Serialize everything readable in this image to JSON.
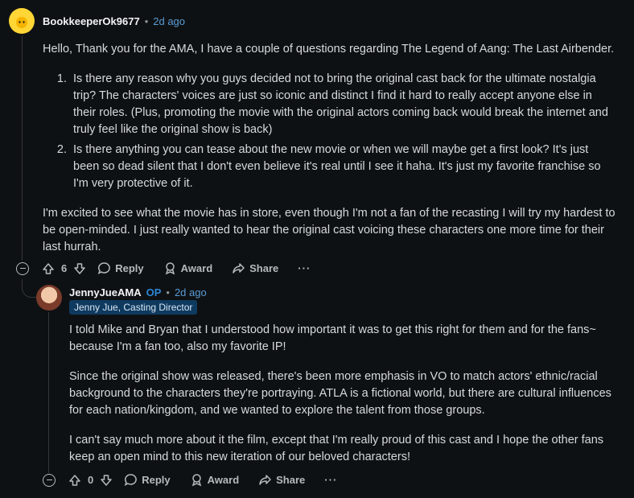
{
  "comment": {
    "username": "BookkeeperOk9677",
    "time": "2d ago",
    "intro": "Hello, Thank you for the AMA, I have a couple of questions regarding The Legend of Aang: The Last Airbender.",
    "items": [
      {
        "num": "1.",
        "text": "Is there any reason why you guys decided not to bring the original cast back for the ultimate nostalgia trip? The characters' voices are just so iconic and distinct I find it hard to really accept anyone else in their roles. (Plus, promoting the movie with the original actors coming back would break the internet and truly feel like the original show is back)"
      },
      {
        "num": "2.",
        "text": "Is there anything you can tease about the new movie or when we will maybe get a first look? It's just been so dead silent that I don't even believe it's real until I see it haha. It's just my favorite franchise so I'm very protective of it."
      }
    ],
    "outro": "I'm excited to see what the movie has in store, even though I'm not a fan of the recasting I will try my hardest to be open-minded. I just really wanted to hear the original cast voicing these characters one more time for their last hurrah.",
    "votes": "6",
    "reply_label": "Reply",
    "award_label": "Award",
    "share_label": "Share",
    "more_label": "···"
  },
  "reply": {
    "username": "JennyJueAMA",
    "op": "OP",
    "time": "2d ago",
    "flair": "Jenny Jue, Casting Director",
    "paragraphs": [
      "I told Mike and Bryan that I understood how important it was to get this right for them and for the fans~ because I'm a fan too, also my favorite IP!",
      "Since the original show was released, there's been more emphasis in VO to match actors' ethnic/racial background to the characters they're portraying. ATLA is a fictional world, but there are cultural influences for each nation/kingdom, and we wanted to explore the talent from those groups.",
      "I can't say much more about it the film, except that I'm really proud of this cast and I hope the other fans keep an open mind to this new iteration of our beloved characters!"
    ],
    "votes": "0",
    "reply_label": "Reply",
    "award_label": "Award",
    "share_label": "Share",
    "more_label": "···"
  },
  "colors": {
    "background": "#0e1113",
    "accent": "#2b86d8",
    "flair_bg": "#0f3a5f"
  }
}
